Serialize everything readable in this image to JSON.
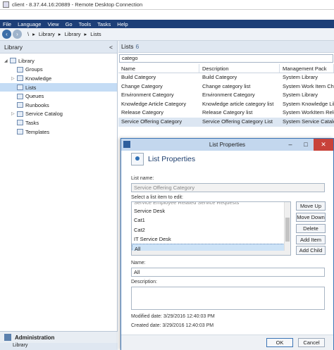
{
  "window": {
    "title": "client - 8.37.44.16:20889 - Remote Desktop Connection"
  },
  "menu": [
    "File",
    "Language",
    "View",
    "Go",
    "Tools",
    "Tasks",
    "Help"
  ],
  "nav": {
    "path": [
      "\\",
      "Library",
      "Library",
      "Lists"
    ]
  },
  "left": {
    "title": "Library",
    "collapse": "<",
    "tree": [
      {
        "label": "Library",
        "indent": 0,
        "expander": "◢",
        "selected": false
      },
      {
        "label": "Groups",
        "indent": 1,
        "expander": "",
        "selected": false
      },
      {
        "label": "Knowledge",
        "indent": 1,
        "expander": "▷",
        "selected": false
      },
      {
        "label": "Lists",
        "indent": 1,
        "expander": "",
        "selected": true
      },
      {
        "label": "Queues",
        "indent": 1,
        "expander": "",
        "selected": false
      },
      {
        "label": "Runbooks",
        "indent": 1,
        "expander": "",
        "selected": false
      },
      {
        "label": "Service Catalog",
        "indent": 1,
        "expander": "▷",
        "selected": false
      },
      {
        "label": "Tasks",
        "indent": 1,
        "expander": "",
        "selected": false
      },
      {
        "label": "Templates",
        "indent": 1,
        "expander": "",
        "selected": false
      }
    ],
    "admin": "Administration",
    "library_bar": "Library"
  },
  "main": {
    "title": "Lists",
    "count": "6",
    "search": "catego",
    "columns": [
      "Name",
      "Description",
      "Management Pack"
    ],
    "rows": [
      [
        "Build Category",
        "Build Category",
        "System Library"
      ],
      [
        "Change Category",
        "Change category list",
        "System Work Item Chan"
      ],
      [
        "Environment Category",
        "Environment Category",
        "System Library"
      ],
      [
        "Knowledge Article Category",
        "Knowledge article category list",
        "System Knowledge Libr"
      ],
      [
        "Release Category",
        "Release Category list",
        "System WorkItem Relea"
      ],
      [
        "Service Offering Category",
        "Service Offering Category List",
        "System Service Catalog"
      ]
    ],
    "selected_row": 5
  },
  "dialog": {
    "title": "List Properties",
    "heading": "List Properties",
    "list_name_label": "List name:",
    "list_name": "Service Offering Category",
    "select_label": "Select a list item to edit:",
    "items": [
      "Service Desk",
      "Cat1",
      "Cat2",
      "IT Service Desk",
      "All"
    ],
    "selected_item": 4,
    "buttons": [
      "Move Up",
      "Move Down",
      "Delete",
      "Add Item",
      "Add Child"
    ],
    "name_label": "Name:",
    "name_value": "All",
    "description_label": "Description:",
    "modified_label": "Modified date: 3/29/2016 12:40:03 PM",
    "created_label": "Created date:  3/29/2016 12:40:03 PM",
    "ok": "OK",
    "cancel": "Cancel"
  }
}
